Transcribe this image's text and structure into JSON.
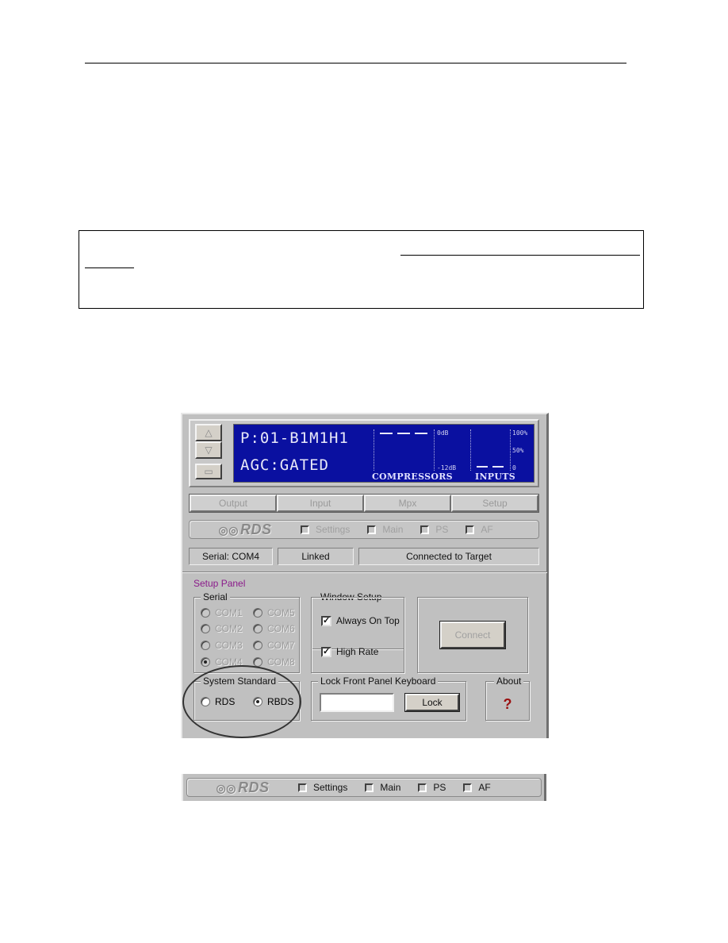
{
  "document": {
    "note_box": {
      "underlined_text_visible": false
    }
  },
  "app": {
    "display": {
      "line1": "P:01-B1M1H1",
      "line2": "AGC:GATED",
      "compressors": {
        "title": "COMPRESSORS",
        "top_label": "0dB",
        "bottom_label": "-12dB"
      },
      "inputs": {
        "title": "INPUTS",
        "top_label": "100%",
        "mid_label": "50%",
        "bottom_label": "0"
      },
      "nav_up_icon": "triangle-up",
      "nav_down_icon": "triangle-down",
      "nav_enter_icon": "rectangle"
    },
    "tabs": [
      {
        "label": "Output"
      },
      {
        "label": "Input"
      },
      {
        "label": "Mpx"
      },
      {
        "label": "Setup"
      }
    ],
    "rds_bar": {
      "logo": "RDS",
      "items": [
        {
          "label": "Settings",
          "checked": false
        },
        {
          "label": "Main",
          "checked": false
        },
        {
          "label": "PS",
          "checked": false
        },
        {
          "label": "AF",
          "checked": false
        }
      ]
    },
    "status": {
      "serial": "Serial: COM4",
      "link": "Linked",
      "connection": "Connected to Target"
    },
    "setup_panel": {
      "title": "Setup Panel",
      "serial_group": {
        "label": "Serial",
        "ports": [
          "COM1",
          "COM2",
          "COM3",
          "COM4",
          "COM5",
          "COM6",
          "COM7",
          "COM8"
        ],
        "selected": "COM4"
      },
      "window_setup": {
        "label": "Window Setup",
        "always_on_top": {
          "label": "Always On Top",
          "checked": true
        },
        "high_rate": {
          "label": "High Rate",
          "checked": true
        }
      },
      "connect_button": "Connect",
      "system_standard": {
        "label": "System Standard",
        "options": [
          "RDS",
          "RBDS"
        ],
        "selected": "RBDS"
      },
      "lock_keyboard": {
        "label": "Lock Front Panel Keyboard",
        "input_value": "",
        "button": "Lock"
      },
      "about": {
        "label": "About",
        "icon": "?"
      }
    }
  },
  "rds_strip": {
    "logo": "RDS",
    "items": [
      {
        "label": "Settings",
        "checked": false
      },
      {
        "label": "Main",
        "checked": false
      },
      {
        "label": "PS",
        "checked": false
      },
      {
        "label": "AF",
        "checked": false
      }
    ]
  }
}
